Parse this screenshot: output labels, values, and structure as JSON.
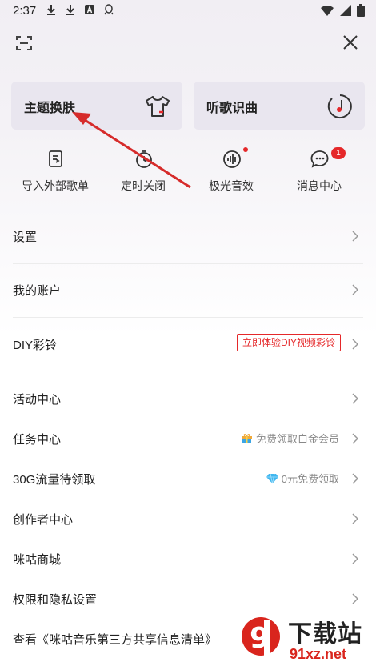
{
  "status": {
    "time": "2:37"
  },
  "cards": [
    {
      "label": "主题换肤",
      "icon": "tshirt-icon"
    },
    {
      "label": "听歌识曲",
      "icon": "music-recognize-icon"
    }
  ],
  "quick": [
    {
      "label": "导入外部歌单",
      "icon": "import-playlist-icon"
    },
    {
      "label": "定时关闭",
      "icon": "timer-icon"
    },
    {
      "label": "极光音效",
      "icon": "sound-effect-icon"
    },
    {
      "label": "消息中心",
      "icon": "message-icon",
      "badge": "1"
    }
  ],
  "menu": {
    "settings": "设置",
    "account": "我的账户",
    "diy": "DIY彩铃",
    "diy_tag": "立即体验DIY视频彩铃",
    "activity": "活动中心",
    "task": "任务中心",
    "task_extra": "免费领取白金会员",
    "traffic": "30G流量待领取",
    "traffic_extra": "0元免费领取",
    "creator": "创作者中心",
    "mall": "咪咕商城",
    "privacy": "权限和隐私设置",
    "third_party": "查看《咪咕音乐第三方共享信息清单》"
  },
  "watermark": {
    "big": "下载站",
    "small": "91xz.net"
  },
  "colors": {
    "accent_red": "#e5282a",
    "card_bg": "#e6e2ec"
  }
}
